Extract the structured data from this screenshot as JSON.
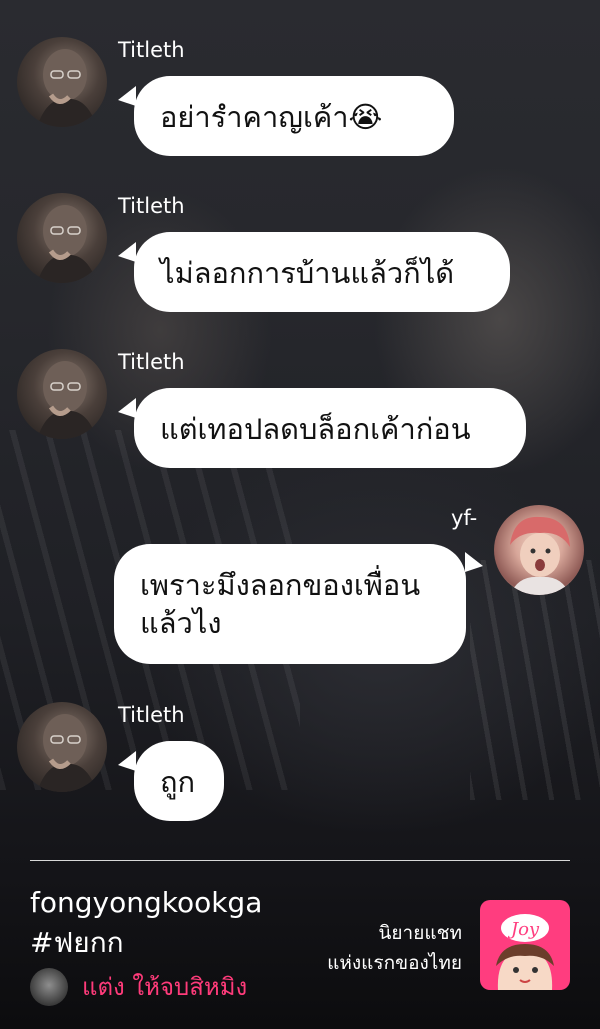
{
  "story": {
    "messages": [
      {
        "sender": "Titleth",
        "text": "อย่ารำคาญเค้า😭",
        "side": "left"
      },
      {
        "sender": "Titleth",
        "text": "ไม่ลอกการบ้านแล้วก็ได้",
        "side": "left"
      },
      {
        "sender": "Titleth",
        "text": "แต่เทอปลดบล็อกเค้าก่อน",
        "side": "left"
      },
      {
        "sender": "yf-",
        "text": "เพราะมึงลอกของเพื่อน",
        "text2": "แล้วไง",
        "side": "right"
      },
      {
        "sender": "Titleth",
        "text": "ถูก",
        "side": "left"
      }
    ]
  },
  "footer": {
    "title": "fongyongkookga",
    "hashtag": "#ฟยกก",
    "author": "แต่ง ให้จบสิหมิง",
    "promo_line1": "นิยายแชท",
    "promo_line2": "แห่งแรกของไทย",
    "logo_text": "Joy"
  },
  "colors": {
    "bubble": "#ffffff",
    "author_accent": "#ff3b7a",
    "logo_bg": "#ff3d7f"
  }
}
